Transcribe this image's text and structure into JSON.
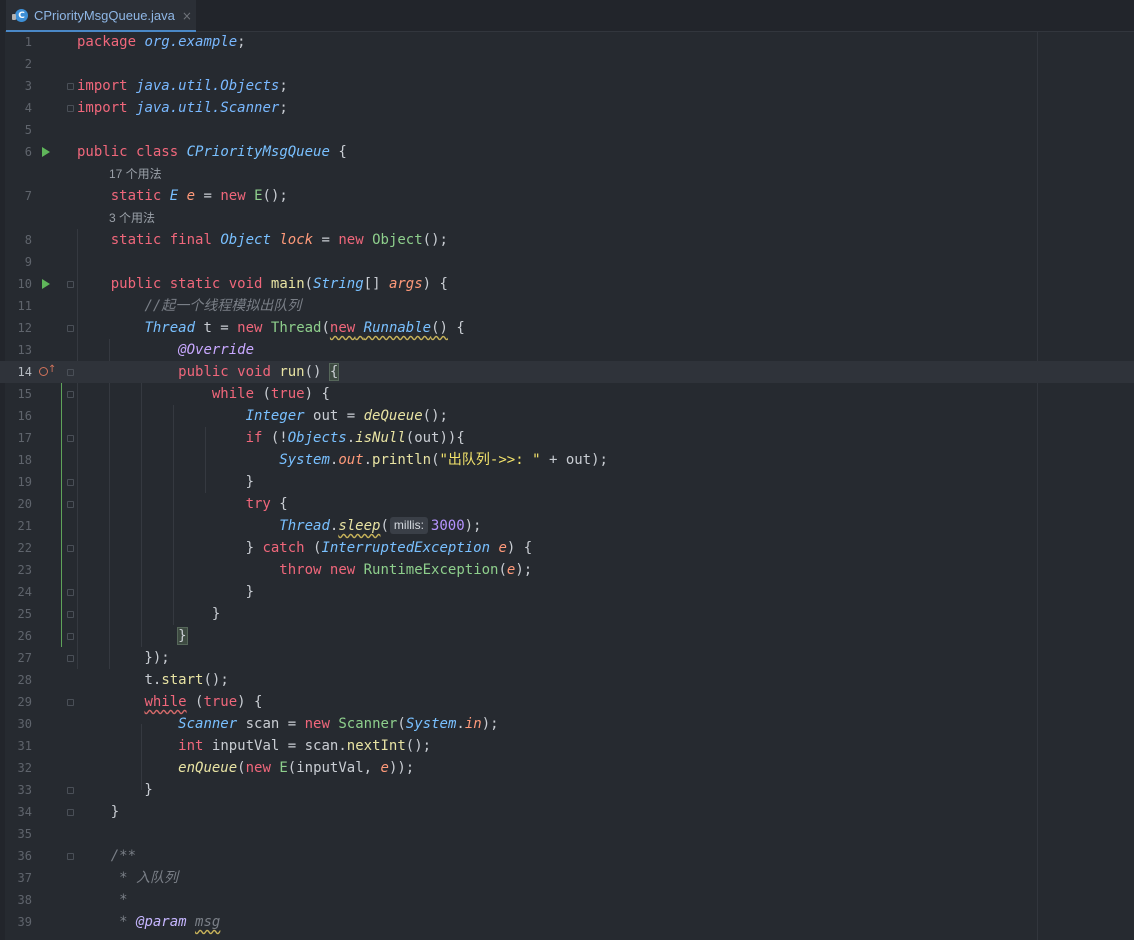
{
  "tab": {
    "label": "CPriorityMsgQueue.java",
    "icon": "java-class-icon",
    "close": "×"
  },
  "hints": {
    "usages_17": "17 个用法",
    "usages_3": "3 个用法",
    "millis": "millis:"
  },
  "lines": {
    "n1": "1",
    "n2": "2",
    "n3": "3",
    "n4": "4",
    "n5": "5",
    "n6": "6",
    "n7": "7",
    "n8": "8",
    "n9": "9",
    "n10": "10",
    "n11": "11",
    "n12": "12",
    "n13": "13",
    "n14": "14",
    "n15": "15",
    "n16": "16",
    "n17": "17",
    "n18": "18",
    "n19": "19",
    "n20": "20",
    "n21": "21",
    "n22": "22",
    "n23": "23",
    "n24": "24",
    "n25": "25",
    "n26": "26",
    "n27": "27",
    "n28": "28",
    "n29": "29",
    "n30": "30",
    "n31": "31",
    "n32": "32",
    "n33": "33",
    "n34": "34",
    "n35": "35",
    "n36": "36",
    "n37": "37",
    "n38": "38",
    "n39": "39"
  },
  "code": {
    "package_kw": "package",
    "package_name": "org.example",
    "import_kw": "import",
    "import1": "java.util.Objects",
    "import2": "java.util.Scanner",
    "public": "public",
    "class": "class",
    "class_name": "CPriorityMsgQueue",
    "static": "static",
    "final": "final",
    "type_E": "E",
    "field_e": "e",
    "new": "new",
    "ctor_E": "E",
    "type_Object": "Object",
    "field_lock": "lock",
    "ctor_Object": "Object",
    "void": "void",
    "main": "main",
    "type_String": "String",
    "args": "args",
    "comment_dequeue": "//起一个线程模拟出队列",
    "type_Thread": "Thread",
    "var_t": "t",
    "ctor_Thread": "Thread",
    "runnable": "Runnable",
    "override": "@Override",
    "run": "run",
    "while": "while",
    "true": "true",
    "type_Integer": "Integer",
    "var_out": "out",
    "deQueue": "deQueue",
    "if": "if",
    "objects": "Objects",
    "isNull": "isNull",
    "system": "System",
    "out_field": "out",
    "println": "println",
    "str_out": "\"出队列->>: \"",
    "try": "try",
    "sleep": "sleep",
    "num_3000": "3000",
    "catch": "catch",
    "exception": "InterruptedException",
    "throw": "throw",
    "runtime_ex": "RuntimeException",
    "start": "start",
    "type_Scanner": "Scanner",
    "var_scan": "scan",
    "ctor_Scanner": "Scanner",
    "in_field": "in",
    "int": "int",
    "var_inputVal": "inputVal",
    "nextInt": "nextInt",
    "enQueue": "enQueue",
    "javadoc_open": "/**",
    "javadoc_enqueue": " * 入队列",
    "javadoc_star": " *",
    "javadoc_param_star": " * ",
    "param_tag": "@param",
    "param_msg": "msg"
  }
}
